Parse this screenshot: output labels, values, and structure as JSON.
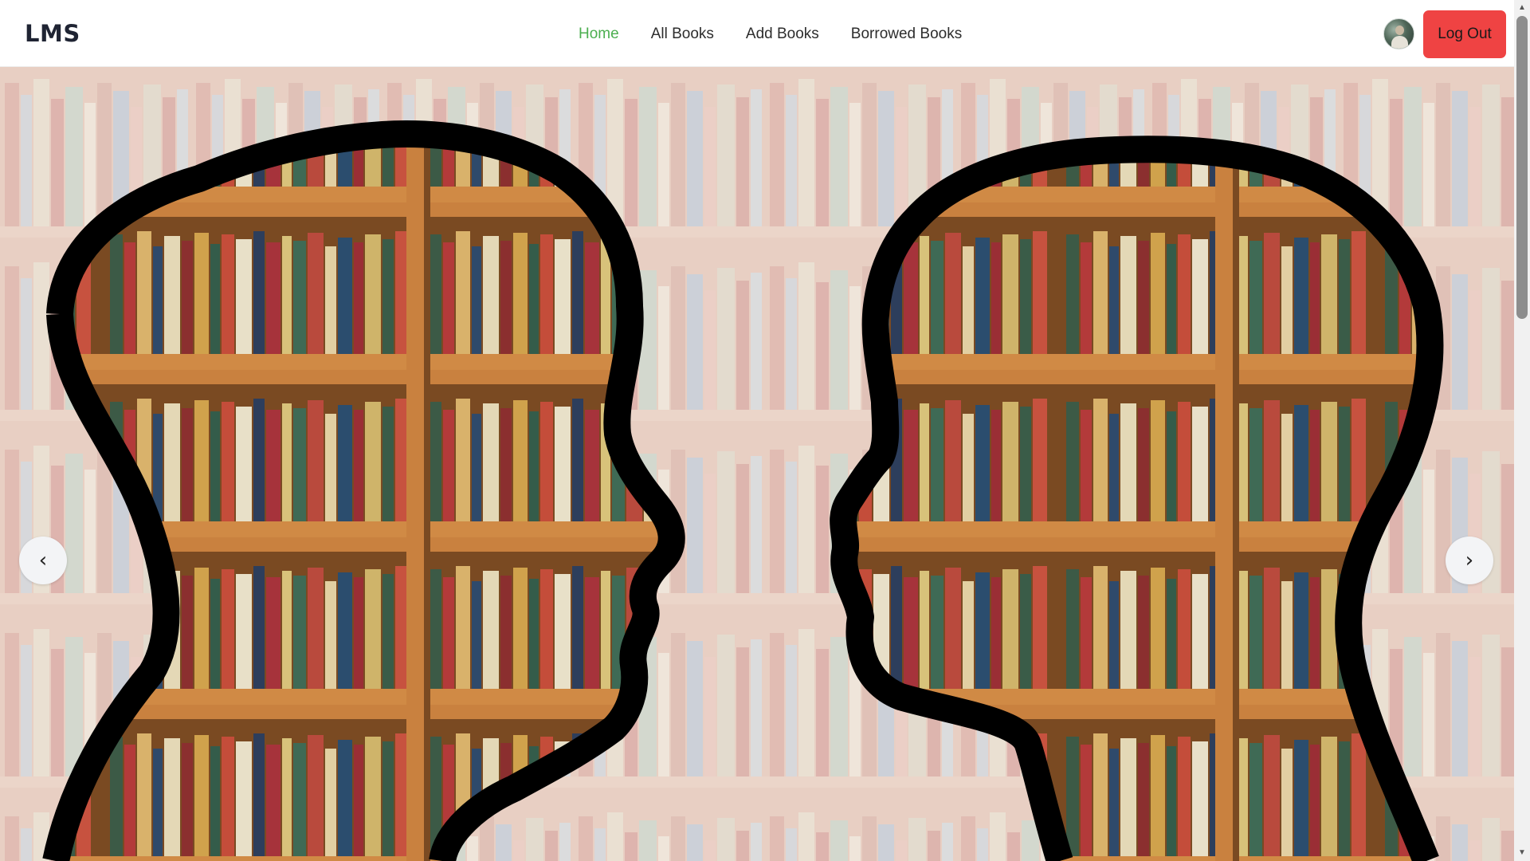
{
  "brand": {
    "logo": "LMS"
  },
  "nav": {
    "links": [
      {
        "label": "Home",
        "active": true
      },
      {
        "label": "All Books",
        "active": false
      },
      {
        "label": "Add Books",
        "active": false
      },
      {
        "label": "Borrowed Books",
        "active": false
      }
    ]
  },
  "user": {
    "avatar_icon": "user-avatar-icon",
    "logout_label": "Log Out"
  },
  "carousel": {
    "prev_symbol": "‹",
    "next_symbol": "›"
  },
  "colors": {
    "accent_active_link": "#4caf50",
    "logout_button": "#ef4343",
    "text_dark": "#1f2433"
  }
}
